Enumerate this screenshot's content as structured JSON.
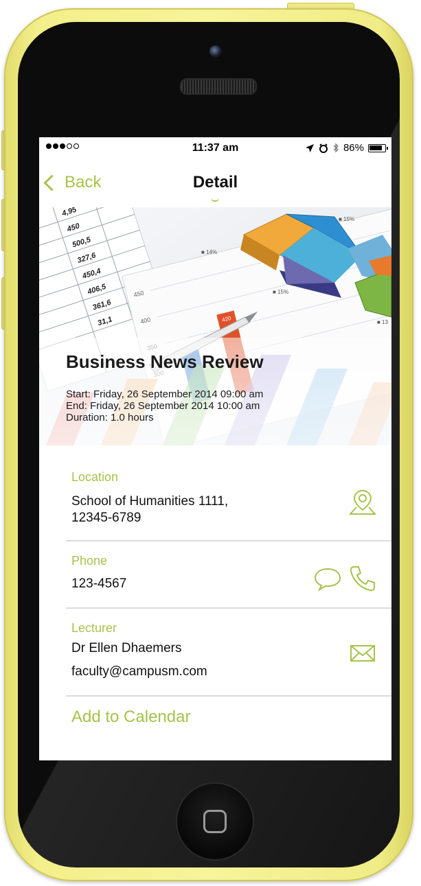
{
  "status_bar": {
    "signal_full": 3,
    "signal_empty": 2,
    "time": "11:37 am",
    "battery_percent": "86%",
    "battery_level": 0.86
  },
  "nav": {
    "back_label": "Back",
    "title": "Detail"
  },
  "event": {
    "title": "Business News Review",
    "start": "Start: Friday, 26 September 2014 09:00 am",
    "end": "End: Friday, 26 September 2014 10:00 am",
    "duration": "Duration: 1.0 hours"
  },
  "hero_image": {
    "table_values": [
      "4,95",
      "450",
      "500,5",
      "327,6",
      "450,4",
      "406,5",
      "361,6",
      "31,1"
    ],
    "axis_labels": [
      "450",
      "400",
      "350",
      "300"
    ],
    "bar_label": "420",
    "pie_labels": [
      "15%",
      "14%",
      "15%",
      "13"
    ]
  },
  "details": {
    "location": {
      "label": "Location",
      "line1": "School of Humanities 1111,",
      "line2": "12345-6789",
      "icon": "map-pin-icon"
    },
    "phone": {
      "label": "Phone",
      "value": "123-4567",
      "icons": [
        "chat-bubble-icon",
        "phone-icon"
      ]
    },
    "lecturer": {
      "label": "Lecturer",
      "name": "Dr Ellen Dhaemers",
      "email": "faculty@campusm.com",
      "icon": "mail-icon"
    }
  },
  "add_to_calendar": "Add to Calendar",
  "colors": {
    "accent": "#a5c34a",
    "phone_body": "#f3ef8a",
    "bezel": "#0c0c0c"
  }
}
